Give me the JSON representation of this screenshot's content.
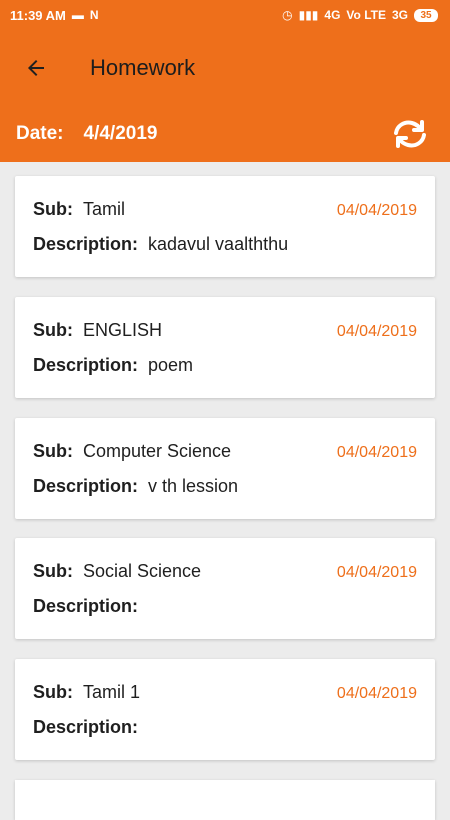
{
  "status_bar": {
    "time": "11:39 AM",
    "network_1": "4G",
    "network_2": "Vo LTE",
    "network_3": "3G",
    "battery": "35"
  },
  "toolbar": {
    "title": "Homework"
  },
  "date_bar": {
    "label": "Date:",
    "value": "4/4/2019"
  },
  "labels": {
    "sub": "Sub:",
    "description": "Description:"
  },
  "homework": [
    {
      "subject": "Tamil",
      "date": "04/04/2019",
      "description": "kadavul vaalththu"
    },
    {
      "subject": "ENGLISH",
      "date": "04/04/2019",
      "description": "poem"
    },
    {
      "subject": "Computer Science",
      "date": "04/04/2019",
      "description": "v th lession"
    },
    {
      "subject": "Social Science",
      "date": "04/04/2019",
      "description": ""
    },
    {
      "subject": "Tamil 1",
      "date": "04/04/2019",
      "description": ""
    }
  ],
  "colors": {
    "accent": "#ee6f1b",
    "background": "#ececec",
    "card": "#ffffff"
  },
  "icons": [
    "back-arrow-icon",
    "refresh-icon",
    "message-icon",
    "notification-n-icon",
    "alarm-icon",
    "signal-icon",
    "battery-icon"
  ]
}
